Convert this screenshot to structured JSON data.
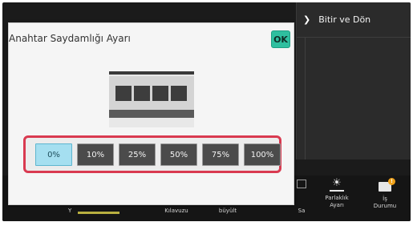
{
  "right_panel": {
    "finish_label": "Bitir ve Dön",
    "finish_icon": "chevron-right-icon"
  },
  "dialog": {
    "title": "Anahtar Saydamlığı Ayarı",
    "ok_label": "OK",
    "options": [
      {
        "label": "0%",
        "selected": true
      },
      {
        "label": "10%",
        "selected": false
      },
      {
        "label": "25%",
        "selected": false
      },
      {
        "label": "50%",
        "selected": false
      },
      {
        "label": "75%",
        "selected": false
      },
      {
        "label": "100%",
        "selected": false
      }
    ]
  },
  "bottom_bar": {
    "item_y": "Y",
    "item_kilavuzu": "Kılavuzu",
    "item_buyult": "büyült",
    "item_sa": "Sa",
    "item_parlaklik_line1": "Parlaklık",
    "item_parlaklik_line2": "Ayarı",
    "item_durum_line1": "İş",
    "item_durum_line2": "Durumu",
    "notification_glyph": "!"
  },
  "colors": {
    "ok_button": "#2fbf9f",
    "selected_option": "#a5dff0",
    "highlight_border": "#d93a50",
    "notification": "#f0a21a"
  }
}
